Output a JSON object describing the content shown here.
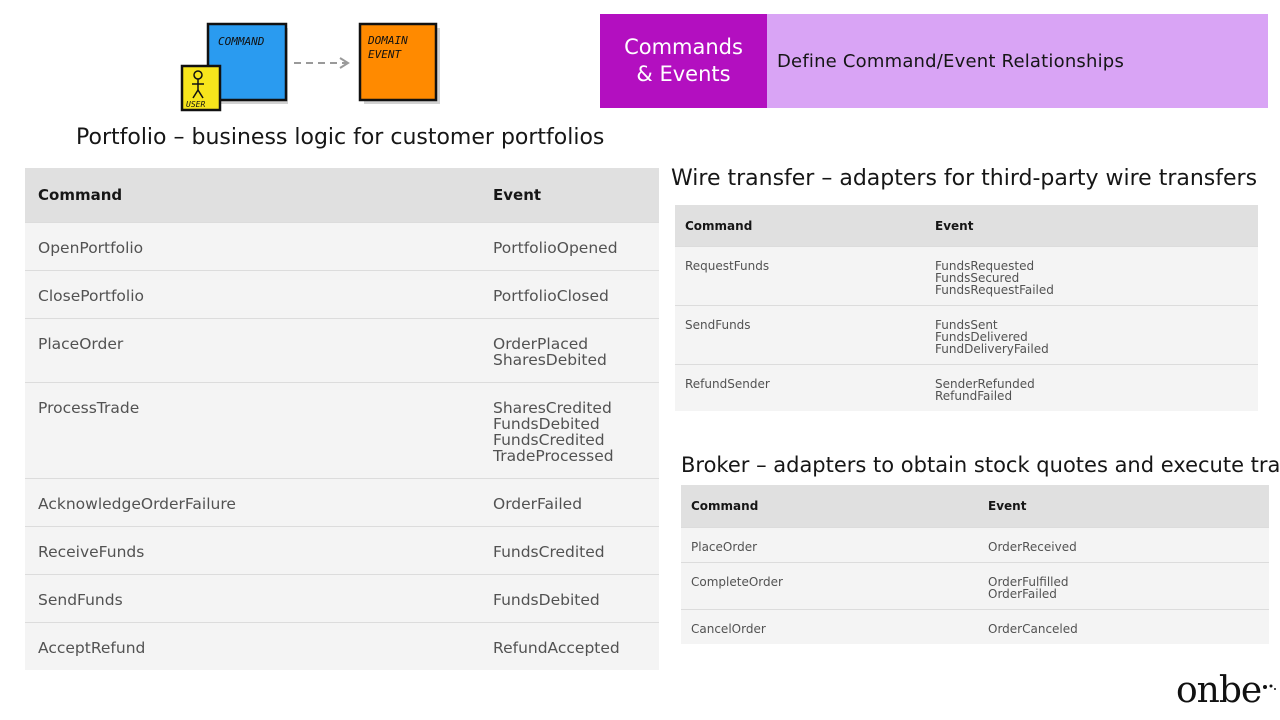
{
  "illustration": {
    "command_note": "COMMAND",
    "user_note": "USER",
    "event_note_line1": "DOMAIN",
    "event_note_line2": "EVENT",
    "colors": {
      "command": "#2a9bf0",
      "user": "#f7e51c",
      "event": "#ff8a00"
    }
  },
  "banner": {
    "section": "Commands & Events",
    "subtitle": "Define Command/Event Relationships",
    "colors": {
      "section_bg": "#b30fc0",
      "subtitle_bg": "#d9a4f5"
    }
  },
  "portfolio": {
    "title": "Portfolio – business logic for customer portfolios",
    "headers": [
      "Command",
      "Event"
    ],
    "rows": [
      {
        "command": "OpenPortfolio",
        "events": [
          "PortfolioOpened"
        ]
      },
      {
        "command": "ClosePortfolio",
        "events": [
          "PortfolioClosed"
        ]
      },
      {
        "command": "PlaceOrder",
        "events": [
          "OrderPlaced",
          "SharesDebited"
        ]
      },
      {
        "command": "ProcessTrade",
        "events": [
          "SharesCredited",
          "FundsDebited",
          "FundsCredited",
          "TradeProcessed"
        ]
      },
      {
        "command": "AcknowledgeOrderFailure",
        "events": [
          "OrderFailed"
        ]
      },
      {
        "command": "ReceiveFunds",
        "events": [
          "FundsCredited"
        ]
      },
      {
        "command": "SendFunds",
        "events": [
          "FundsDebited"
        ]
      },
      {
        "command": "AcceptRefund",
        "events": [
          "RefundAccepted"
        ]
      }
    ]
  },
  "wire": {
    "title": "Wire transfer – adapters for third-party wire transfers",
    "headers": [
      "Command",
      "Event"
    ],
    "rows": [
      {
        "command": "RequestFunds",
        "events": [
          "FundsRequested",
          "FundsSecured",
          "FundsRequestFailed"
        ]
      },
      {
        "command": "SendFunds",
        "events": [
          "FundsSent",
          "FundsDelivered",
          "FundDeliveryFailed"
        ]
      },
      {
        "command": "RefundSender",
        "events": [
          "SenderRefunded",
          "RefundFailed"
        ]
      }
    ]
  },
  "broker": {
    "title": "Broker – adapters to obtain stock quotes and execute trades",
    "headers": [
      "Command",
      "Event"
    ],
    "rows": [
      {
        "command": "PlaceOrder",
        "events": [
          "OrderReceived"
        ]
      },
      {
        "command": "CompleteOrder",
        "events": [
          "OrderFulfilled",
          "OrderFailed"
        ]
      },
      {
        "command": "CancelOrder",
        "events": [
          "OrderCanceled"
        ]
      }
    ]
  },
  "logo": {
    "text": "onbe"
  }
}
